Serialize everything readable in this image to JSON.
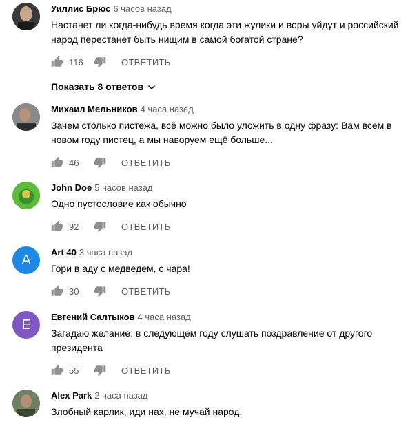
{
  "comments": [
    {
      "author": "Уиллис Брюс",
      "time": "6 часов назад",
      "text": "Настанет ли когда-нибудь время когда эти жулики и воры уйдут и российский народ перестанет быть нищим в самой богатой стране?",
      "likes": "116",
      "reply_label": "ОТВЕТИТЬ",
      "show_replies": "Показать 8 ответов"
    },
    {
      "author": "Михаил Мельников",
      "time": "4 часа назад",
      "text": "Зачем столько пистежа, всё можно было уложить в одну фразу: Вам всем в новом году пистец, а мы наворуем ещё больше...",
      "likes": "46",
      "reply_label": "ОТВЕТИТЬ"
    },
    {
      "author": "John Doe",
      "time": "5 часов назад",
      "text": "Одно пустословие как обычно",
      "likes": "92",
      "reply_label": "ОТВЕТИТЬ"
    },
    {
      "author": "Art 40",
      "time": "3 часа назад",
      "text": "Гори в аду с медведем, с  чара!",
      "likes": "30",
      "reply_label": "ОТВЕТИТЬ",
      "avatar_letter": "A",
      "avatar_color": "#1e88e5"
    },
    {
      "author": "Евгений Салтыков",
      "time": "4 часа назад",
      "text": "Загадаю желание: в следующем году слушать поздравление от другого президента",
      "likes": "55",
      "reply_label": "ОТВЕТИТЬ",
      "avatar_letter": "E",
      "avatar_color": "#7e57c2"
    },
    {
      "author": "Alex Park",
      "time": "2 часа назад",
      "text": "Злобный карлик, иди нах, не мучай народ."
    }
  ],
  "icons": {
    "like": "thumb-up-icon",
    "dislike": "thumb-down-icon",
    "chevron": "chevron-down-icon"
  }
}
